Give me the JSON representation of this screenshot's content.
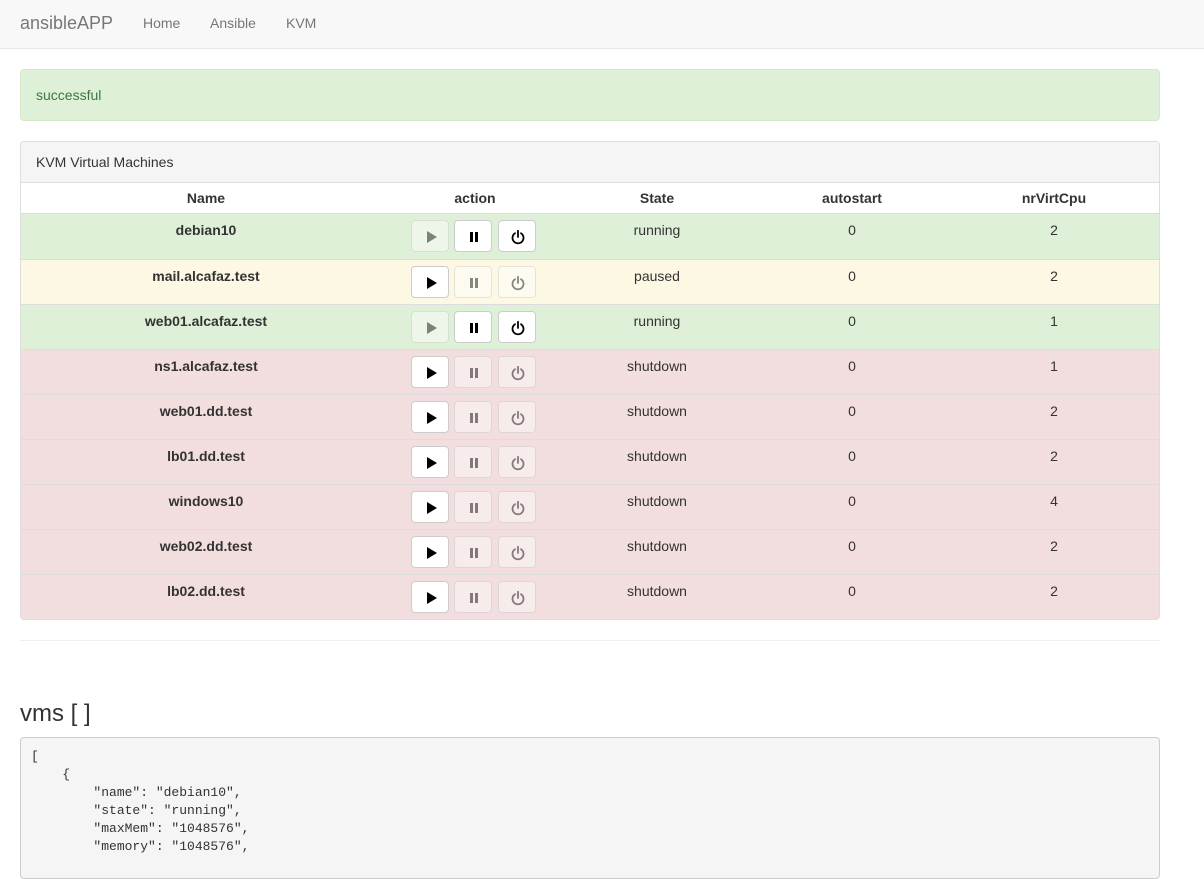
{
  "navbar": {
    "brand": "ansibleAPP",
    "links": [
      "Home",
      "Ansible",
      "KVM"
    ]
  },
  "alert": {
    "text": "successful"
  },
  "panel": {
    "title": "KVM Virtual Machines",
    "columns": [
      "Name",
      "action",
      "State",
      "autostart",
      "nrVirtCpu"
    ],
    "rows": [
      {
        "name": "debian10",
        "state": "running",
        "autostart": "0",
        "cpu": "2",
        "status": "success"
      },
      {
        "name": "mail.alcafaz.test",
        "state": "paused",
        "autostart": "0",
        "cpu": "2",
        "status": "warning"
      },
      {
        "name": "web01.alcafaz.test",
        "state": "running",
        "autostart": "0",
        "cpu": "1",
        "status": "success"
      },
      {
        "name": "ns1.alcafaz.test",
        "state": "shutdown",
        "autostart": "0",
        "cpu": "1",
        "status": "danger"
      },
      {
        "name": "web01.dd.test",
        "state": "shutdown",
        "autostart": "0",
        "cpu": "2",
        "status": "danger"
      },
      {
        "name": "lb01.dd.test",
        "state": "shutdown",
        "autostart": "0",
        "cpu": "2",
        "status": "danger"
      },
      {
        "name": "windows10",
        "state": "shutdown",
        "autostart": "0",
        "cpu": "4",
        "status": "danger"
      },
      {
        "name": "web02.dd.test",
        "state": "shutdown",
        "autostart": "0",
        "cpu": "2",
        "status": "danger"
      },
      {
        "name": "lb02.dd.test",
        "state": "shutdown",
        "autostart": "0",
        "cpu": "2",
        "status": "danger"
      }
    ],
    "action_icons": [
      "play-icon",
      "pause-icon",
      "power-icon"
    ]
  },
  "vms_section": {
    "heading": "vms [ ]",
    "code_lines": [
      "[",
      "    {",
      "        \"name\": \"debian10\",",
      "        \"state\": \"running\",",
      "        \"maxMem\": \"1048576\",",
      "        \"memory\": \"1048576\","
    ]
  },
  "colors": {
    "success_row": "#dff0d8",
    "warning_row": "#fcf8e3",
    "danger_row": "#f2dede",
    "alert_text": "#3c763d"
  }
}
